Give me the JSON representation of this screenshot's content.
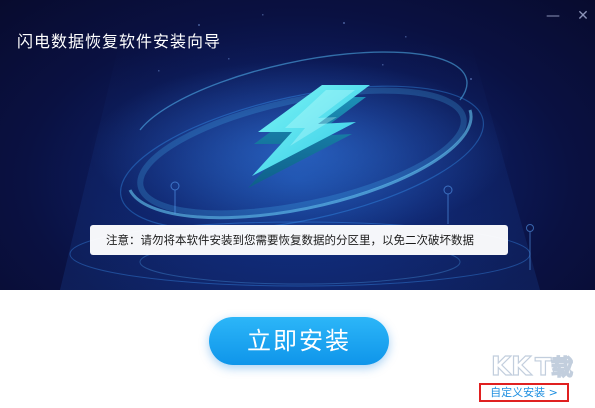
{
  "window": {
    "title": "闪电数据恢复软件安装向导",
    "minimize_icon": "minimize-icon",
    "close_icon": "close-icon"
  },
  "hero": {
    "logo_icon": "lightning-bolt-icon",
    "notice": "注意：请勿将本软件安装到您需要恢复数据的分区里，以免二次破坏数据"
  },
  "actions": {
    "install_label": "立即安装",
    "custom_install_label": "自定义安装 >"
  },
  "watermark": {
    "text": "KKT下载"
  },
  "colors": {
    "hero_bg": "#0a1142",
    "accent": "#1ea3f2",
    "bolt": "#3fe0e8",
    "highlight_border": "#e02020",
    "link": "#1e8fe0"
  }
}
